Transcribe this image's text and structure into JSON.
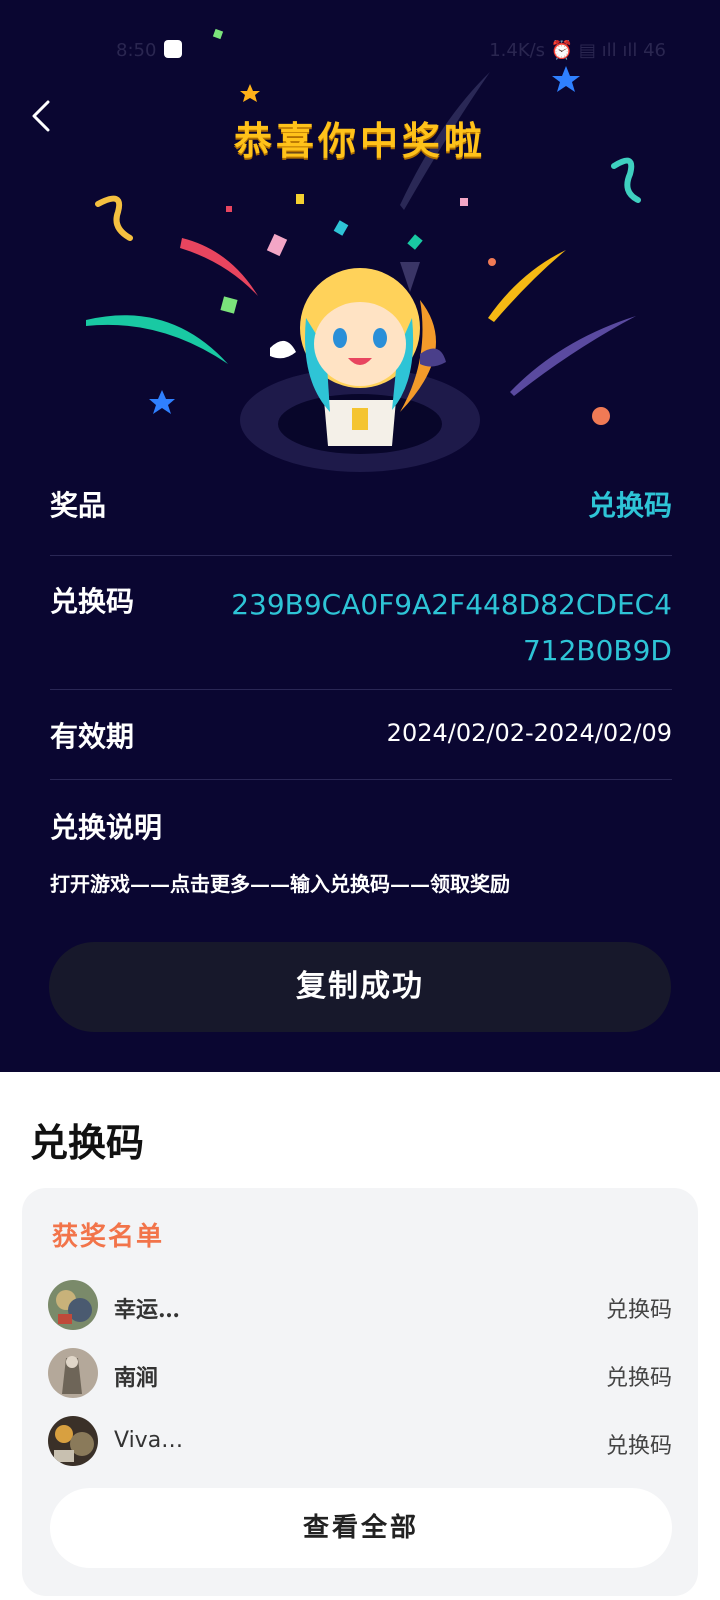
{
  "status_bar": {
    "time": "8:50",
    "right_text": "1.4K/s ⏰ ▤ ıll ıll 46"
  },
  "header": {
    "title": "恭喜你中奖啦"
  },
  "prize": {
    "prize_label": "奖品",
    "prize_value": "兑换码",
    "code_label": "兑换码",
    "code_line1": "239B9CA0F9A2F448D82CDEC4",
    "code_line2": "712B0B9D",
    "validity_label": "有效期",
    "validity_value": "2024/02/02-2024/02/09",
    "instructions_label": "兑换说明",
    "instructions_text": "打开游戏——点击更多——输入兑换码——领取奖励"
  },
  "copy_button": {
    "label": "复制成功"
  },
  "section": {
    "title": "兑换码"
  },
  "winners": {
    "title": "获奖名单",
    "rows": [
      {
        "name": "幸运…",
        "prize": "兑换码"
      },
      {
        "name": "南涧",
        "prize": "兑换码"
      },
      {
        "name": "Viva…",
        "prize": "兑换码"
      }
    ],
    "view_all_label": "查看全部"
  },
  "colors": {
    "background_dark": "#0a0631",
    "accent_cyan": "#2ec4d6",
    "title_gold": "#ffc21a",
    "winners_orange": "#f2744a"
  },
  "icons": [
    "back-chevron-icon",
    "status-dot-icon"
  ]
}
